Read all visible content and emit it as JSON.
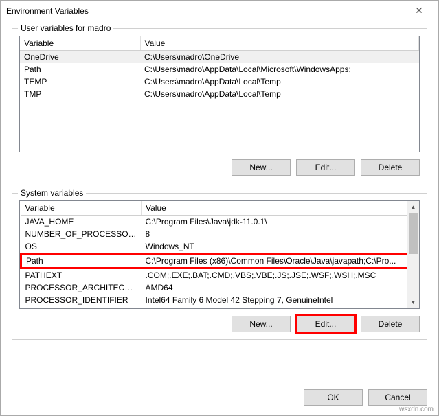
{
  "window": {
    "title": "Environment Variables"
  },
  "userVars": {
    "groupLabel": "User variables for madro",
    "columns": {
      "variable": "Variable",
      "value": "Value"
    },
    "rows": [
      {
        "variable": "OneDrive",
        "value": "C:\\Users\\madro\\OneDrive"
      },
      {
        "variable": "Path",
        "value": "C:\\Users\\madro\\AppData\\Local\\Microsoft\\WindowsApps;"
      },
      {
        "variable": "TEMP",
        "value": "C:\\Users\\madro\\AppData\\Local\\Temp"
      },
      {
        "variable": "TMP",
        "value": "C:\\Users\\madro\\AppData\\Local\\Temp"
      }
    ],
    "buttons": {
      "new": "New...",
      "edit": "Edit...",
      "delete": "Delete"
    }
  },
  "sysVars": {
    "groupLabel": "System variables",
    "columns": {
      "variable": "Variable",
      "value": "Value"
    },
    "rows": [
      {
        "variable": "JAVA_HOME",
        "value": "C:\\Program Files\\Java\\jdk-11.0.1\\"
      },
      {
        "variable": "NUMBER_OF_PROCESSORS",
        "value": "8"
      },
      {
        "variable": "OS",
        "value": "Windows_NT"
      },
      {
        "variable": "Path",
        "value": "C:\\Program Files (x86)\\Common Files\\Oracle\\Java\\javapath;C:\\Pro..."
      },
      {
        "variable": "PATHEXT",
        "value": ".COM;.EXE;.BAT;.CMD;.VBS;.VBE;.JS;.JSE;.WSF;.WSH;.MSC"
      },
      {
        "variable": "PROCESSOR_ARCHITECTURE",
        "value": "AMD64"
      },
      {
        "variable": "PROCESSOR_IDENTIFIER",
        "value": "Intel64 Family 6 Model 42 Stepping 7, GenuineIntel"
      }
    ],
    "buttons": {
      "new": "New...",
      "edit": "Edit...",
      "delete": "Delete"
    }
  },
  "footer": {
    "ok": "OK",
    "cancel": "Cancel"
  },
  "watermark": "wsxdn.com"
}
